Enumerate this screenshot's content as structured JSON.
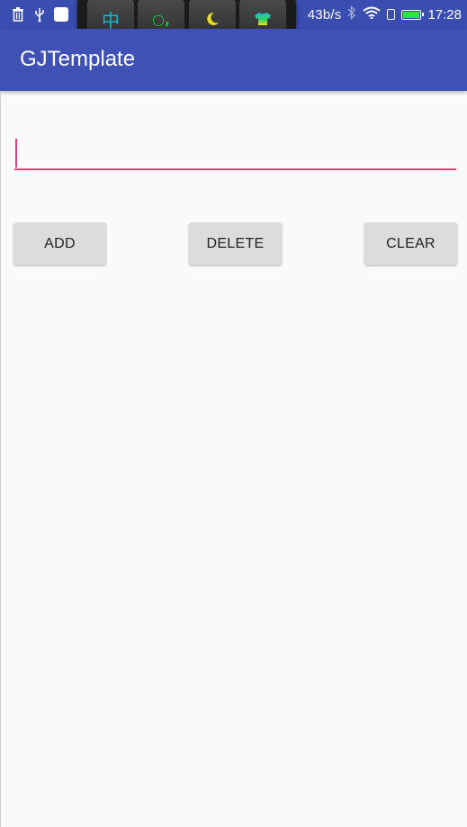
{
  "status_bar": {
    "network_speed": "43b/s",
    "time": "17:28",
    "icons": [
      "trash-icon",
      "usb-icon",
      "notification-square-icon",
      "bluetooth-icon",
      "wifi-icon",
      "sim-icon",
      "battery-icon"
    ],
    "battery_level": 1.0,
    "colors": {
      "background": "#3a4db0",
      "battery_fill": "#2fe04a"
    }
  },
  "ime_overlay": {
    "keys": [
      {
        "name": "chinese-input-key",
        "glyph": "中",
        "color": "#14b8c8"
      },
      {
        "name": "punctuation-key",
        "glyph": "○,",
        "color": "#18c040"
      },
      {
        "name": "night-mode-key",
        "icon": "moon-icon",
        "color": "#e8e020"
      },
      {
        "name": "skin-key",
        "icon": "shirt-icon",
        "color": "#20c0e0"
      }
    ]
  },
  "app_bar": {
    "title": "GJTemplate",
    "color": "#3f51b5"
  },
  "input": {
    "value": "",
    "accent": "#e0407a"
  },
  "buttons": {
    "add": "ADD",
    "delete": "DELETE",
    "clear": "CLEAR"
  }
}
